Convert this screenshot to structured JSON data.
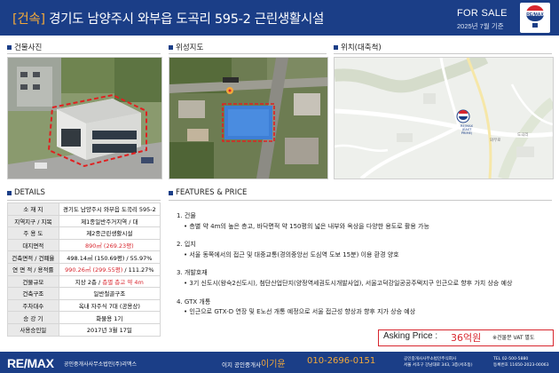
{
  "header": {
    "title_prefix": "[건속]",
    "title": " 경기도 남양주시 와부읍 도곡리 595-2 근린생활시설",
    "for_sale": "FOR SALE",
    "date": "2025년 7월 기준",
    "logo_text": "RE/MAX"
  },
  "sections": {
    "photo": "건물사진",
    "satellite": "위성지도",
    "location": "위치(대축척)",
    "details": "DETAILS",
    "features": "FEATURES & PRICE"
  },
  "map": {
    "marker_brand": "RE/MAX",
    "marker_sub": "(EAST PRIME)",
    "label_road": "와부로",
    "label_right": "도곡리"
  },
  "details": [
    {
      "label": "소 재 지",
      "value": "경기도 남양주시 와부읍 도곡리 595-2"
    },
    {
      "label": "지역지구 / 지목",
      "value": "제1종일반주거지역 / 대"
    },
    {
      "label": "주 용 도",
      "value": "제2종근린생활시설"
    },
    {
      "label": "대지면적",
      "value": "890㎡ (269.23평)",
      "highlight": true
    },
    {
      "label": "건축면적 / 건폐율",
      "value": "498.14㎡ (150.69평) / 55.97%"
    },
    {
      "label": "연 면 적 / 용적률",
      "value_red": "990.26㎡ (299.55평)",
      "value_rest": " / 111.27%"
    },
    {
      "label": "건물규모",
      "value_plain": "지상 2층 / ",
      "value_red": "층별 층고 약 4m"
    },
    {
      "label": "건축구조",
      "value": "일반철골구조"
    },
    {
      "label": "주차대수",
      "value": "옥내 자주식 7대 (공용상)"
    },
    {
      "label": "승 강 기",
      "value": "화물용 1기"
    },
    {
      "label": "사용승인일",
      "value": "2017년 3월 17일"
    }
  ],
  "features": [
    {
      "heading": "1. 건물",
      "bullets": [
        "층별 약 4m의 높은 층고, 바닥면적 약 150평의 넓은 내부와 옥상을 다양한 용도로 활용 가능"
      ]
    },
    {
      "heading": "2. 입지",
      "bullets": [
        "서울 동쪽에서의 접근 및 대중교통(경의중앙선 도심역 도보 15분) 이용 환경 양호"
      ]
    },
    {
      "heading": "3. 개발호재",
      "bullets": [
        "3기 신도시(왕숙2신도시), 첨단산업단지(양정역세권도시개발사업), 서울고덕강일공공주택지구 인근으로 향후 가치 상승 예상"
      ]
    },
    {
      "heading": "4. GTX 개통",
      "bullets": [
        "인근으로 GTX-D 연장 및 E노선 개통 예정으로 서울 접근성 향상과 향후 지가 상승 예상"
      ]
    }
  ],
  "price": {
    "label": "Asking Price : ",
    "value": "36억원",
    "note": "※건물분 VAT 별도"
  },
  "footer": {
    "brand": "RE/MAX",
    "office": "공인중개사사무소법인(주)리맥스",
    "agent_label": "이지 공인중개사",
    "agent_name": "이기윤",
    "agent_phone": "010-2696-0151",
    "line1": "공인중개사사무소법인주식회사",
    "line2": "서울 서초구 강남대로 343, 3층(서초동)",
    "tel": "TEL  02-500-5880",
    "reg": "등록번호  11650-2023-00063"
  },
  "colors": {
    "brand_blue": "#1b3e87",
    "accent_orange": "#f2a93b",
    "accent_red": "#d8262e"
  }
}
